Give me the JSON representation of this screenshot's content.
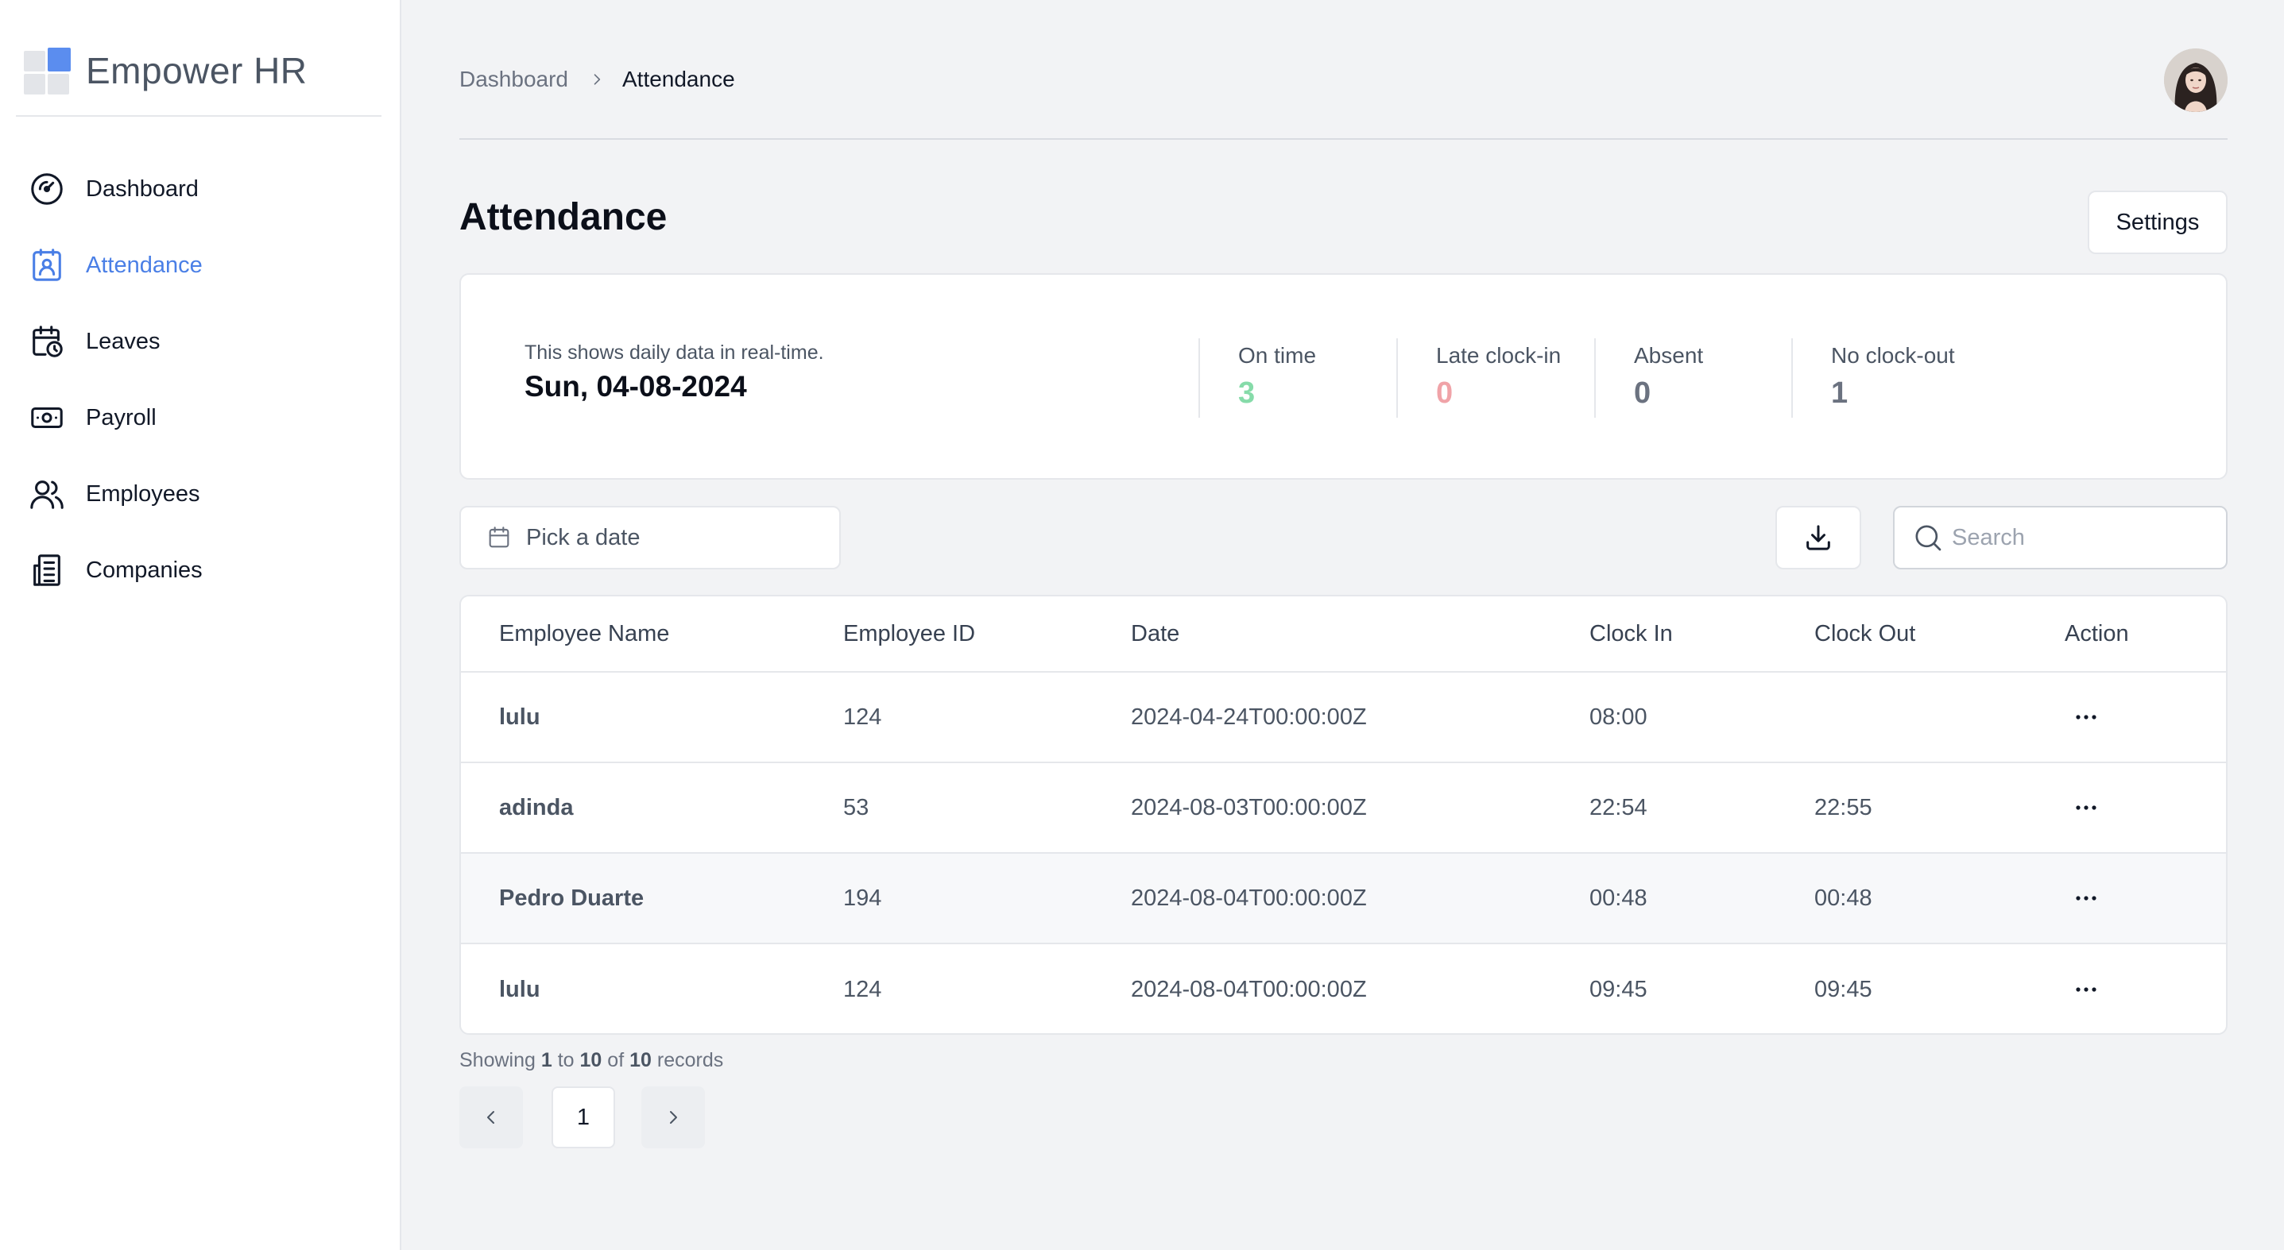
{
  "app": {
    "name": "Empower HR"
  },
  "sidebar": {
    "items": [
      {
        "label": "Dashboard",
        "icon": "gauge-icon",
        "active": false
      },
      {
        "label": "Attendance",
        "icon": "attendance-badge-icon",
        "active": true
      },
      {
        "label": "Leaves",
        "icon": "calendar-clock-icon",
        "active": false
      },
      {
        "label": "Payroll",
        "icon": "money-icon",
        "active": false
      },
      {
        "label": "Employees",
        "icon": "users-icon",
        "active": false
      },
      {
        "label": "Companies",
        "icon": "building-icon",
        "active": false
      }
    ]
  },
  "breadcrumb": {
    "parent": "Dashboard",
    "current": "Attendance"
  },
  "page": {
    "title": "Attendance",
    "settings_label": "Settings"
  },
  "summary": {
    "note": "This shows daily data in real-time.",
    "date": "Sun, 04-08-2024",
    "stats": [
      {
        "label": "On time",
        "value": "3",
        "color": "#86dba9"
      },
      {
        "label": "Late clock-in",
        "value": "0",
        "color": "#f0a3a8"
      },
      {
        "label": "Absent",
        "value": "0",
        "color": "#6b7280"
      },
      {
        "label": "No clock-out",
        "value": "1",
        "color": "#6b7280"
      }
    ]
  },
  "toolbar": {
    "date_placeholder": "Pick a date",
    "search_placeholder": "Search"
  },
  "table": {
    "columns": [
      "Employee Name",
      "Employee ID",
      "Date",
      "Clock In",
      "Clock Out",
      "Action"
    ],
    "rows": [
      {
        "name": "lulu",
        "id": "124",
        "date": "2024-04-24T00:00:00Z",
        "clock_in": "08:00",
        "clock_out": ""
      },
      {
        "name": "adinda",
        "id": "53",
        "date": "2024-08-03T00:00:00Z",
        "clock_in": "22:54",
        "clock_out": "22:55"
      },
      {
        "name": "Pedro Duarte",
        "id": "194",
        "date": "2024-08-04T00:00:00Z",
        "clock_in": "00:48",
        "clock_out": "00:48"
      },
      {
        "name": "lulu",
        "id": "124",
        "date": "2024-08-04T00:00:00Z",
        "clock_in": "09:45",
        "clock_out": "09:45"
      }
    ]
  },
  "pagination": {
    "showing_label": "Showing",
    "from": "1",
    "to_label": "to",
    "to": "10",
    "of_label": "of",
    "total": "10",
    "records_label": "records",
    "current_page": "1"
  },
  "colors": {
    "accent": "#4a7fe6",
    "on_time": "#86dba9",
    "late": "#f0a3a8"
  }
}
